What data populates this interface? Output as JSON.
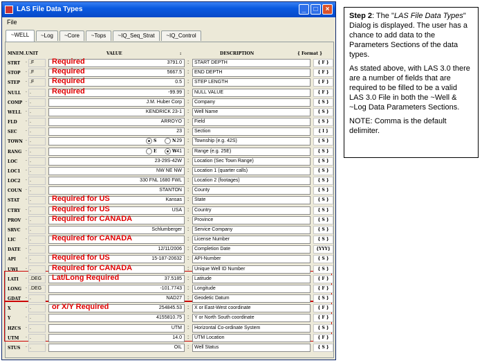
{
  "window": {
    "title": "LAS File Data Types"
  },
  "menu": {
    "file": "File"
  },
  "tabs": [
    "~WELL",
    "~Log",
    "~Core",
    "~Tops",
    "~IQ_Seq_Strat",
    "~IQ_Control"
  ],
  "headers": {
    "mnem": "MNEM",
    "unit": ".UNIT",
    "value": "VALUE",
    "colon": ":",
    "description": "DESCRIPTION",
    "format": "{ Format }"
  },
  "rows": [
    {
      "mnem": "STRT",
      "unit": ".F",
      "value": "3791.0",
      "desc": "START DEPTH",
      "format": "{ F }",
      "note": "Required"
    },
    {
      "mnem": "STOP",
      "unit": ".F",
      "value": "5667.5",
      "desc": "END DEPTH",
      "format": "{ F }",
      "note": "Required"
    },
    {
      "mnem": "STEP",
      "unit": ".F",
      "value": "0.5",
      "desc": "STEP LENGTH",
      "format": "{ F }",
      "note": "Required"
    },
    {
      "mnem": "NULL",
      "unit": ".",
      "value": "-99.99",
      "desc": "NULL VALUE",
      "format": "{ F }",
      "note": "Required"
    },
    {
      "mnem": "COMP",
      "unit": ".",
      "value": "J.M. Huber Corp",
      "desc": "Company",
      "format": "{ S }",
      "note": ""
    },
    {
      "mnem": "WELL",
      "unit": ".",
      "value": "KENDRICK 23-1",
      "desc": "Well Name",
      "format": "{ S }",
      "note": ""
    },
    {
      "mnem": "FLD",
      "unit": ".",
      "value": "ARROYO",
      "desc": "Field",
      "format": "{ S }",
      "note": ""
    },
    {
      "mnem": "SEC",
      "unit": ".",
      "value": "23",
      "desc": "Section",
      "format": "{ I }",
      "note": ""
    },
    {
      "mnem": "TOWN",
      "unit": ".",
      "value": "29",
      "desc": "Township (e.g. 42S)",
      "format": "{ S }",
      "note": "",
      "radios": [
        "S",
        "N"
      ],
      "selected": 0
    },
    {
      "mnem": "RANG",
      "unit": ".",
      "value": "41",
      "desc": "Range (e.g. 25E)",
      "format": "{ S }",
      "note": "",
      "radios": [
        "E",
        "W"
      ],
      "selected": 1
    },
    {
      "mnem": "LOC",
      "unit": ".",
      "value": "23-29S-42W",
      "desc": "Location (Sec Town Range)",
      "format": "{ S }",
      "note": ""
    },
    {
      "mnem": "LOC1",
      "unit": ".",
      "value": "NW NE NW",
      "desc": "Location 1 (quarter calls)",
      "format": "{ S }",
      "note": ""
    },
    {
      "mnem": "LOC2",
      "unit": ".",
      "value": "330 FNL 1680 FWL",
      "desc": "Location 2 (footages)",
      "format": "{ S }",
      "note": ""
    },
    {
      "mnem": "COUN",
      "unit": ".",
      "value": "STANTON",
      "desc": "County",
      "format": "{ S }",
      "note": ""
    },
    {
      "mnem": "STAT",
      "unit": ".",
      "value": "Kansas",
      "desc": "State",
      "format": "{ S }",
      "note": "Required for US"
    },
    {
      "mnem": "CTRY",
      "unit": ".",
      "value": "USA",
      "desc": "Country",
      "format": "{ S }",
      "note": "Required for US"
    },
    {
      "mnem": "PROV",
      "unit": ".",
      "value": "",
      "desc": "Province",
      "format": "{ S }",
      "note": "Required for CANADA"
    },
    {
      "mnem": "SRVC",
      "unit": ".",
      "value": "Schlumberger",
      "desc": "Service Company",
      "format": "{ S }",
      "note": ""
    },
    {
      "mnem": "LIC",
      "unit": ".",
      "value": "",
      "desc": "License Number",
      "format": "{ S }",
      "note": "Required for CANADA"
    },
    {
      "mnem": "DATE",
      "unit": ".",
      "value": "12/11/2006",
      "desc": "Completion Date",
      "format": "{YYY}",
      "note": ""
    },
    {
      "mnem": "API",
      "unit": ".",
      "value": "15-187-20632",
      "desc": "API-Number",
      "format": "{ S }",
      "note": "Required for US"
    },
    {
      "mnem": "UWI",
      "unit": ".",
      "value": "",
      "desc": "Unique Well ID Number",
      "format": "{ S }",
      "note": "Required for CANADA"
    },
    {
      "mnem": "LATI",
      "unit": ".DEG",
      "value": "37.5185",
      "desc": "Latitude",
      "format": "{ F }",
      "note": "Lat/Long Required"
    },
    {
      "mnem": "LONG",
      "unit": ".DEG",
      "value": "-101.7743",
      "desc": "Longitude",
      "format": "{ F }",
      "note": ""
    },
    {
      "mnem": "GDAT",
      "unit": ".",
      "value": "NAD27",
      "desc": "Geodetic Datum",
      "format": "{ S }",
      "note": ""
    },
    {
      "mnem": "X",
      "unit": ".",
      "value": "254845.53",
      "desc": "X or East-West coordinate",
      "format": "{ F }",
      "note": "or X/Y Required"
    },
    {
      "mnem": "Y",
      "unit": ".",
      "value": "4155810.75",
      "desc": "Y or North South coordinate",
      "format": "{ F }",
      "note": ""
    },
    {
      "mnem": "HZCS",
      "unit": ".",
      "value": "UTM",
      "desc": "Horizontal Co-ordinate System",
      "format": "{ S }",
      "note": ""
    },
    {
      "mnem": "UTM",
      "unit": ".",
      "value": "14.0",
      "desc": "UTM Location",
      "format": "{ F }",
      "note": ""
    },
    {
      "mnem": "STUS",
      "unit": ".",
      "value": "OIL",
      "desc": "Well Status",
      "format": "{ S }",
      "note": ""
    }
  ],
  "note_box": {
    "step": "Step 2",
    "p1_a": ": The \"",
    "p1_em": "LAS File Data Types",
    "p1_b": "\" Dialog is displayed.  The user has a chance to add data to the Parameters Sections of the data types.",
    "p2": "As stated above, with LAS 3.0 there are a number of fields that are required to be filled to be a valid LAS 3.0 File in both the ~Well & ~Log Data Parameters Sections.",
    "p3": "NOTE: Comma is the default delimiter."
  },
  "colors": {
    "title_bar": "#0a5ae0",
    "required_text": "#e00000",
    "highlight_box": "#cc0000",
    "window_bg": "#ece9d8"
  }
}
